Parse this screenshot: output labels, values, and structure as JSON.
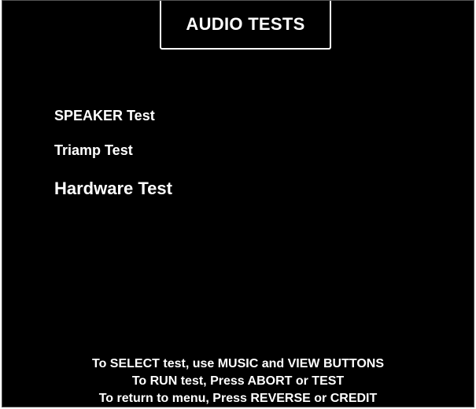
{
  "header": {
    "title": "AUDIO TESTS"
  },
  "menu": {
    "items": [
      {
        "label": "SPEAKER Test"
      },
      {
        "label": "Triamp Test"
      },
      {
        "label": "Hardware Test"
      }
    ]
  },
  "instructions": {
    "lines": [
      "To SELECT test, use MUSIC and VIEW BUTTONS",
      "To RUN test, Press ABORT or TEST",
      "To return to menu, Press REVERSE or CREDIT"
    ]
  },
  "colors": {
    "background": "#000000",
    "text": "#ffffff"
  }
}
